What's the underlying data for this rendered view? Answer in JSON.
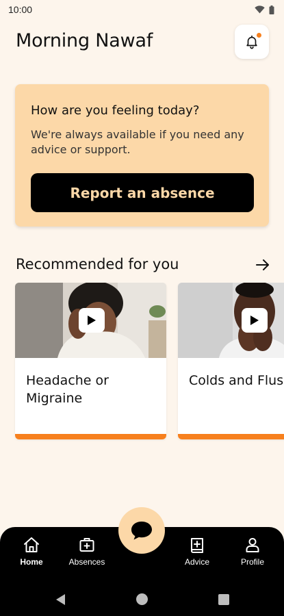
{
  "status_bar": {
    "time": "10:00"
  },
  "header": {
    "greeting": "Morning Nawaf",
    "notification_icon": "bell-icon",
    "has_unread": true
  },
  "feeling_card": {
    "title": "How are you feeling today?",
    "body": "We're always available if you need any advice or support.",
    "button_label": "Report an absence"
  },
  "recommended": {
    "title": "Recommended for you",
    "items": [
      {
        "title": "Headache or Migraine",
        "media": "video"
      },
      {
        "title": "Colds and Flus",
        "media": "video"
      }
    ]
  },
  "bottom_nav": {
    "items": [
      {
        "label": "Home",
        "icon": "home-icon",
        "active": true
      },
      {
        "label": "Absences",
        "icon": "medical-bag-icon",
        "active": false
      },
      {
        "label": "Advice",
        "icon": "medical-book-icon",
        "active": false
      },
      {
        "label": "Profile",
        "icon": "person-icon",
        "active": false
      }
    ],
    "chat_icon": "chat-bubble-icon"
  },
  "colors": {
    "background": "#fdf5ec",
    "accent_peach": "#fcd8a8",
    "accent_orange": "#f7801e",
    "nav_background": "#000000"
  }
}
